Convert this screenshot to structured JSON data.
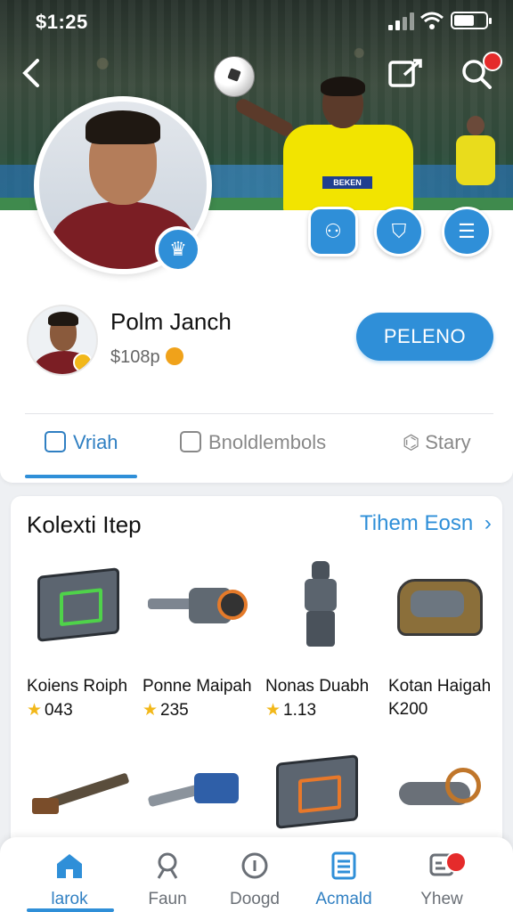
{
  "status": {
    "time": "$1:25"
  },
  "profile": {
    "name": "Polm Janch",
    "coins": "$108p",
    "primary_button": "PELENO"
  },
  "tabs": [
    {
      "label": "Vriah"
    },
    {
      "label": "Bnoldlembols"
    },
    {
      "label": "Stary"
    }
  ],
  "collection": {
    "title": "Kolexti Itep",
    "link": "Tihem Eosn",
    "items": [
      {
        "name": "Koiens Roiph",
        "price": "043",
        "star": true
      },
      {
        "name": "Ponne Maipah",
        "price": "235",
        "star": true
      },
      {
        "name": "Nonas Duabh",
        "price": "1.13",
        "star": true
      },
      {
        "name": "Kotan Haigah",
        "price": "K200",
        "star": false
      }
    ]
  },
  "hero": {
    "sponsor": "BEKEN"
  },
  "bottom_nav": [
    {
      "label": "larok",
      "icon": "home-icon"
    },
    {
      "label": "Faun",
      "icon": "user-icon"
    },
    {
      "label": "Doogd",
      "icon": "info-icon"
    },
    {
      "label": "Acmald",
      "icon": "list-icon"
    },
    {
      "label": "Yhew",
      "icon": "chat-icon"
    }
  ],
  "colors": {
    "accent": "#2f8fd8",
    "badge": "#e52b2b",
    "star": "#f2b81a"
  }
}
